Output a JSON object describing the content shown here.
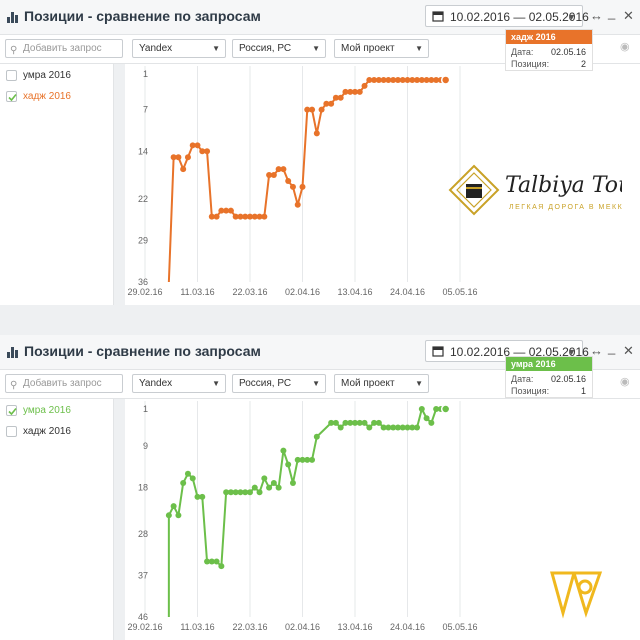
{
  "panel1": {
    "title": "Позиции - сравнение по запросам",
    "date_range": "10.02.2016 — 02.05.2016",
    "search_placeholder": "Добавить запрос",
    "engine": "Yandex",
    "region": "Россия, РС",
    "project": "Мой проект",
    "keywords": [
      {
        "label": "умра 2016",
        "checked": false
      },
      {
        "label": "хадж 2016",
        "checked": true
      }
    ],
    "accent": "#e8732a",
    "tooltip": {
      "title": "хадж 2016",
      "date_label": "Дата:",
      "date": "02.05.16",
      "position_label": "Позиция:",
      "position": "2"
    },
    "chart_data": {
      "type": "line",
      "series_name": "хадж 2016",
      "x_ticks": [
        "29.02.16",
        "11.03.16",
        "22.03.16",
        "02.04.16",
        "13.04.16",
        "24.04.16",
        "05.05.16"
      ],
      "y_ticks": [
        "1",
        "7",
        "14",
        "22",
        "29",
        "36"
      ],
      "y_reversed": true,
      "grid": "vertical",
      "points": [
        [
          "2016-03-05",
          36
        ],
        [
          "2016-03-06",
          15
        ],
        [
          "2016-03-07",
          15
        ],
        [
          "2016-03-08",
          17
        ],
        [
          "2016-03-09",
          15
        ],
        [
          "2016-03-10",
          13
        ],
        [
          "2016-03-11",
          13
        ],
        [
          "2016-03-12",
          14
        ],
        [
          "2016-03-13",
          14
        ],
        [
          "2016-03-14",
          25
        ],
        [
          "2016-03-15",
          25
        ],
        [
          "2016-03-16",
          24
        ],
        [
          "2016-03-17",
          24
        ],
        [
          "2016-03-18",
          24
        ],
        [
          "2016-03-19",
          25
        ],
        [
          "2016-03-20",
          25
        ],
        [
          "2016-03-21",
          25
        ],
        [
          "2016-03-22",
          25
        ],
        [
          "2016-03-23",
          25
        ],
        [
          "2016-03-24",
          25
        ],
        [
          "2016-03-25",
          25
        ],
        [
          "2016-03-26",
          18
        ],
        [
          "2016-03-27",
          18
        ],
        [
          "2016-03-28",
          17
        ],
        [
          "2016-03-29",
          17
        ],
        [
          "2016-03-30",
          19
        ],
        [
          "2016-03-31",
          20
        ],
        [
          "2016-04-01",
          23
        ],
        [
          "2016-04-02",
          20
        ],
        [
          "2016-04-03",
          7
        ],
        [
          "2016-04-04",
          7
        ],
        [
          "2016-04-05",
          11
        ],
        [
          "2016-04-06",
          7
        ],
        [
          "2016-04-07",
          6
        ],
        [
          "2016-04-08",
          6
        ],
        [
          "2016-04-09",
          5
        ],
        [
          "2016-04-10",
          5
        ],
        [
          "2016-04-11",
          4
        ],
        [
          "2016-04-12",
          4
        ],
        [
          "2016-04-13",
          4
        ],
        [
          "2016-04-14",
          4
        ],
        [
          "2016-04-15",
          3
        ],
        [
          "2016-04-16",
          2
        ],
        [
          "2016-04-17",
          2
        ],
        [
          "2016-04-18",
          2
        ],
        [
          "2016-04-19",
          2
        ],
        [
          "2016-04-20",
          2
        ],
        [
          "2016-04-21",
          2
        ],
        [
          "2016-04-22",
          2
        ],
        [
          "2016-04-23",
          2
        ],
        [
          "2016-04-24",
          2
        ],
        [
          "2016-04-25",
          2
        ],
        [
          "2016-04-26",
          2
        ],
        [
          "2016-04-27",
          2
        ],
        [
          "2016-04-28",
          2
        ],
        [
          "2016-04-29",
          2
        ],
        [
          "2016-04-30",
          2
        ],
        [
          "2016-05-01",
          2
        ],
        [
          "2016-05-02",
          2
        ]
      ]
    }
  },
  "panel2": {
    "title": "Позиции - сравнение по запросам",
    "date_range": "10.02.2016 — 02.05.2016",
    "search_placeholder": "Добавить запрос",
    "engine": "Yandex",
    "region": "Россия, РС",
    "project": "Мой проект",
    "keywords": [
      {
        "label": "умра 2016",
        "checked": true
      },
      {
        "label": "хадж 2016",
        "checked": false
      }
    ],
    "accent": "#6cbf4a",
    "tooltip": {
      "title": "умра 2016",
      "date_label": "Дата:",
      "date": "02.05.16",
      "position_label": "Позиция:",
      "position": "1"
    },
    "chart_data": {
      "type": "line",
      "series_name": "умра 2016",
      "x_ticks": [
        "29.02.16",
        "11.03.16",
        "22.03.16",
        "02.04.16",
        "13.04.16",
        "24.04.16",
        "05.05.16"
      ],
      "y_ticks": [
        "1",
        "9",
        "18",
        "28",
        "37",
        "46"
      ],
      "y_reversed": true,
      "grid": "vertical",
      "points": [
        [
          "2016-03-05",
          46
        ],
        [
          "2016-03-05",
          24
        ],
        [
          "2016-03-06",
          22
        ],
        [
          "2016-03-07",
          24
        ],
        [
          "2016-03-08",
          17
        ],
        [
          "2016-03-09",
          15
        ],
        [
          "2016-03-10",
          16
        ],
        [
          "2016-03-11",
          20
        ],
        [
          "2016-03-12",
          20
        ],
        [
          "2016-03-13",
          34
        ],
        [
          "2016-03-14",
          34
        ],
        [
          "2016-03-15",
          34
        ],
        [
          "2016-03-16",
          35
        ],
        [
          "2016-03-17",
          19
        ],
        [
          "2016-03-18",
          19
        ],
        [
          "2016-03-19",
          19
        ],
        [
          "2016-03-20",
          19
        ],
        [
          "2016-03-21",
          19
        ],
        [
          "2016-03-22",
          19
        ],
        [
          "2016-03-23",
          18
        ],
        [
          "2016-03-24",
          19
        ],
        [
          "2016-03-25",
          16
        ],
        [
          "2016-03-26",
          18
        ],
        [
          "2016-03-27",
          17
        ],
        [
          "2016-03-28",
          18
        ],
        [
          "2016-03-29",
          10
        ],
        [
          "2016-03-30",
          13
        ],
        [
          "2016-03-31",
          17
        ],
        [
          "2016-04-01",
          12
        ],
        [
          "2016-04-02",
          12
        ],
        [
          "2016-04-03",
          12
        ],
        [
          "2016-04-04",
          12
        ],
        [
          "2016-04-05",
          7
        ],
        [
          "2016-04-08",
          4
        ],
        [
          "2016-04-09",
          4
        ],
        [
          "2016-04-10",
          5
        ],
        [
          "2016-04-11",
          4
        ],
        [
          "2016-04-12",
          4
        ],
        [
          "2016-04-13",
          4
        ],
        [
          "2016-04-14",
          4
        ],
        [
          "2016-04-15",
          4
        ],
        [
          "2016-04-16",
          5
        ],
        [
          "2016-04-17",
          4
        ],
        [
          "2016-04-18",
          4
        ],
        [
          "2016-04-19",
          5
        ],
        [
          "2016-04-20",
          5
        ],
        [
          "2016-04-21",
          5
        ],
        [
          "2016-04-22",
          5
        ],
        [
          "2016-04-23",
          5
        ],
        [
          "2016-04-24",
          5
        ],
        [
          "2016-04-25",
          5
        ],
        [
          "2016-04-26",
          5
        ],
        [
          "2016-04-27",
          1
        ],
        [
          "2016-04-28",
          3
        ],
        [
          "2016-04-29",
          4
        ],
        [
          "2016-04-30",
          1
        ],
        [
          "2016-05-01",
          1
        ],
        [
          "2016-05-02",
          1
        ]
      ]
    }
  },
  "watermark": {
    "name": "Talbiya Tour",
    "tagline": "ЛЕГКАЯ ДОРОГА В МЕККУ",
    "color": "#c9a227"
  }
}
